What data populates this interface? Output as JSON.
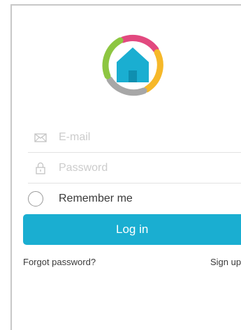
{
  "login": {
    "email_placeholder": "E-mail",
    "password_placeholder": "Password",
    "remember_label": "Remember me",
    "login_label": "Log in",
    "forgot_label": "Forgot password?",
    "signup_label": "Sign up"
  },
  "icons": {
    "logo": "home-logo-icon",
    "email": "envelope-icon",
    "password": "lock-icon",
    "remember": "radio-circle-icon"
  },
  "colors": {
    "accent": "#1aaed1",
    "logo_pink": "#e2497f",
    "logo_yellow": "#f6b829",
    "logo_green": "#8dc641",
    "logo_gray": "#a7a7a7"
  }
}
